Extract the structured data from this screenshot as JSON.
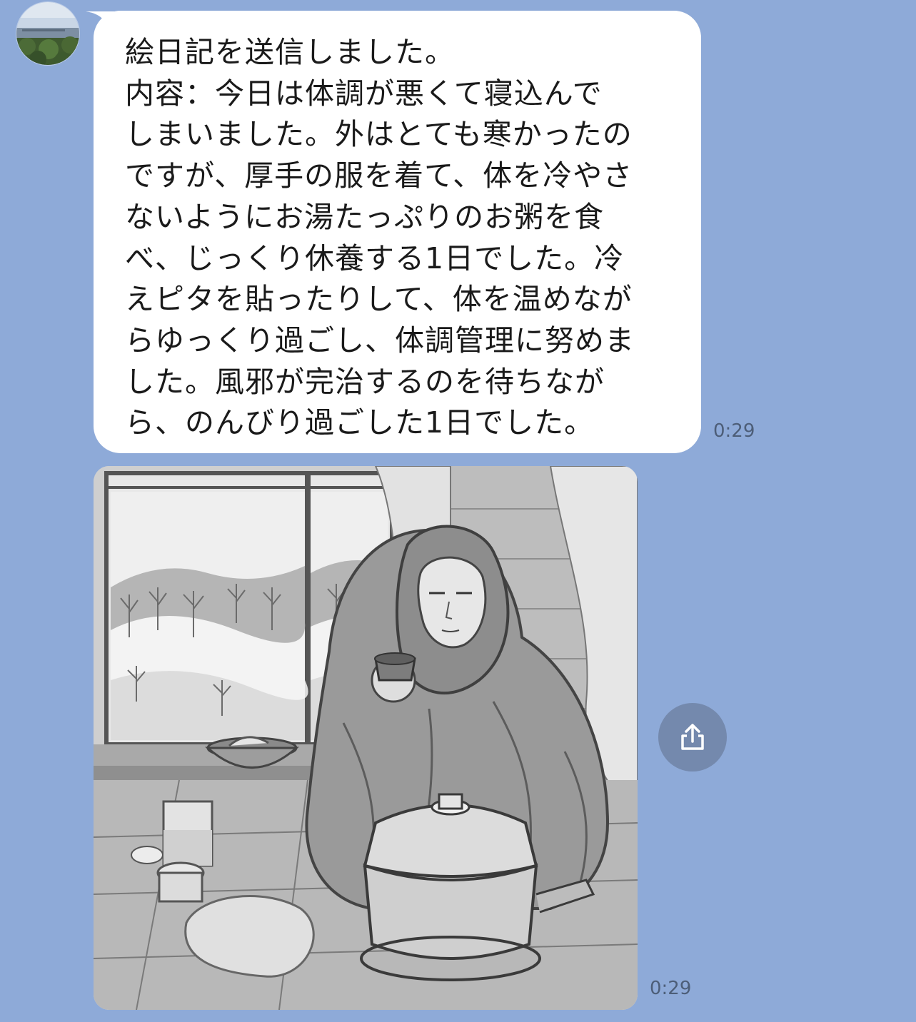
{
  "message": {
    "lines": [
      "絵日記を送信しました。",
      "内容：今日は体調が悪くて寝込んで",
      "しまいました。外はとても寒かったの",
      "ですが、厚手の服を着て、体を冷やさ",
      "ないようにお湯たっぷりのお粥を食",
      "べ、じっくり休養する1日でした。冷",
      "えピタを貼ったりして、体を温めなが",
      "らゆっくり過ごし、体調管理に努めま",
      "した。風邪が完治するのを待ちなが",
      "ら、のんびり過ごした1日でした。"
    ],
    "time": "0:29"
  },
  "image_message": {
    "time": "0:29"
  },
  "colors": {
    "chat_background": "#8eaad8",
    "bubble": "#ffffff",
    "share_button": "#7489ad"
  },
  "icons": {
    "share": "share-icon"
  }
}
